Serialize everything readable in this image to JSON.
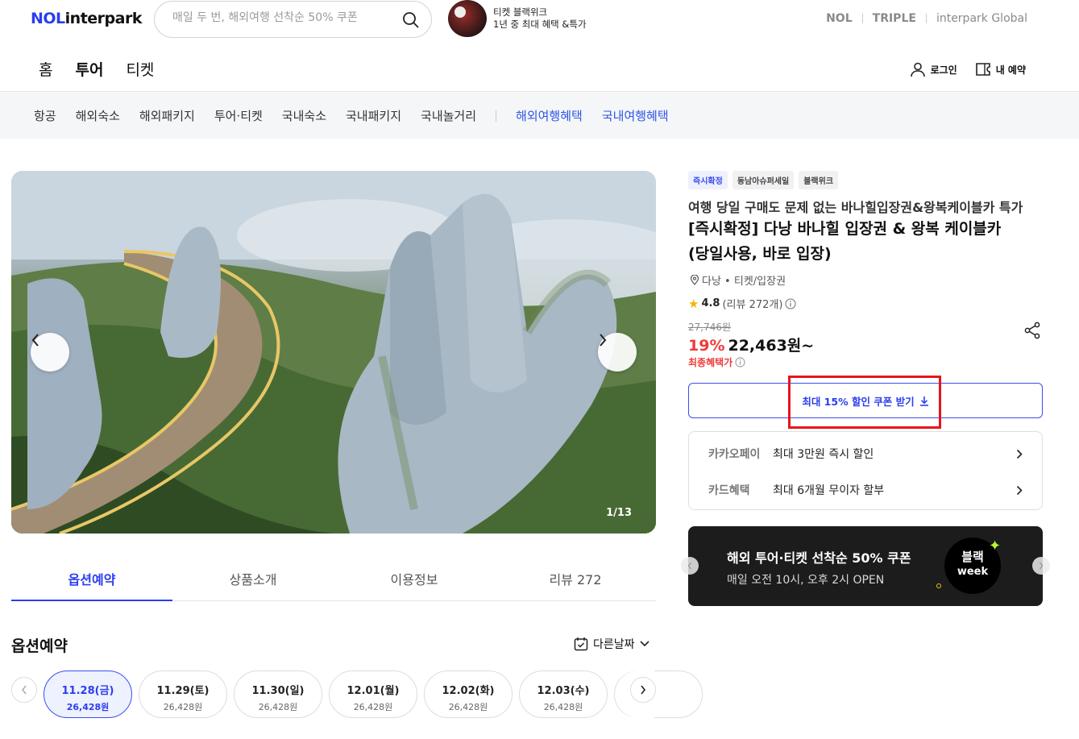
{
  "header": {
    "logo_nol": "NOL",
    "logo_text": "interpark",
    "search_placeholder": "매일 두 번, 해외여행 선착순 50% 쿠폰",
    "promo_line1": "티켓 블랙위크",
    "promo_line2": "1년 중 최대 혜택 &특가",
    "brands": [
      "NOL",
      "TRIPLE",
      "interpark Global"
    ]
  },
  "main_nav": [
    "홈",
    "투어",
    "티켓"
  ],
  "user_links": {
    "login": "로그인",
    "my_reservation": "내 예약"
  },
  "sub_nav": {
    "items": [
      "항공",
      "해외숙소",
      "해외패키지",
      "투어·티켓",
      "국내숙소",
      "국내패키지",
      "국내놀거리"
    ],
    "highlights": [
      "해외여행혜택",
      "국내여행혜택"
    ]
  },
  "gallery": {
    "counter": "1/13"
  },
  "tabs": [
    "옵션예약",
    "상품소개",
    "이용정보",
    "리뷰 272"
  ],
  "option_section": {
    "title": "옵션예약",
    "other_date": "다른날짜"
  },
  "dates": [
    {
      "date": "11.28(금)",
      "price": "26,428원"
    },
    {
      "date": "11.29(토)",
      "price": "26,428원"
    },
    {
      "date": "11.30(일)",
      "price": "26,428원"
    },
    {
      "date": "12.01(월)",
      "price": "26,428원"
    },
    {
      "date": "12.02(화)",
      "price": "26,428원"
    },
    {
      "date": "12.03(수)",
      "price": "26,428원"
    }
  ],
  "product": {
    "badges": [
      "즉시확정",
      "동남아슈퍼세일",
      "블랙위크"
    ],
    "subtitle": "여행 당일 구매도 문제 없는 바나힐입장권&왕복케이블카 특가",
    "title_line1": "[즉시확정] 다낭 바나힐 입장권 & 왕복 케이블카",
    "title_line2": "(당일사용, 바로 입장)",
    "location": "다낭 • 티켓/입장권",
    "rating": "4.8",
    "reviews": "(리뷰 272개)",
    "original_price": "27,746원",
    "discount": "19%",
    "price": "22,463원~",
    "final_benefit": "최종혜택가"
  },
  "coupon_button": "최대 15% 할인 쿠폰 받기",
  "benefits": [
    {
      "key": "카카오페이",
      "value": "최대 3만원 즉시 할인"
    },
    {
      "key": "카드혜택",
      "value": "최대 6개월 무이자 할부"
    }
  ],
  "banner": {
    "title": "해외 투어·티켓 선착순 50% 쿠폰",
    "subtitle": "매일 오전 10시, 오후 2시 OPEN",
    "badge_line1": "블랙",
    "badge_line2": "week"
  },
  "colors": {
    "brand": "#2b3df0",
    "sale": "#f03a3a",
    "highlight_box": "#e8141b"
  }
}
